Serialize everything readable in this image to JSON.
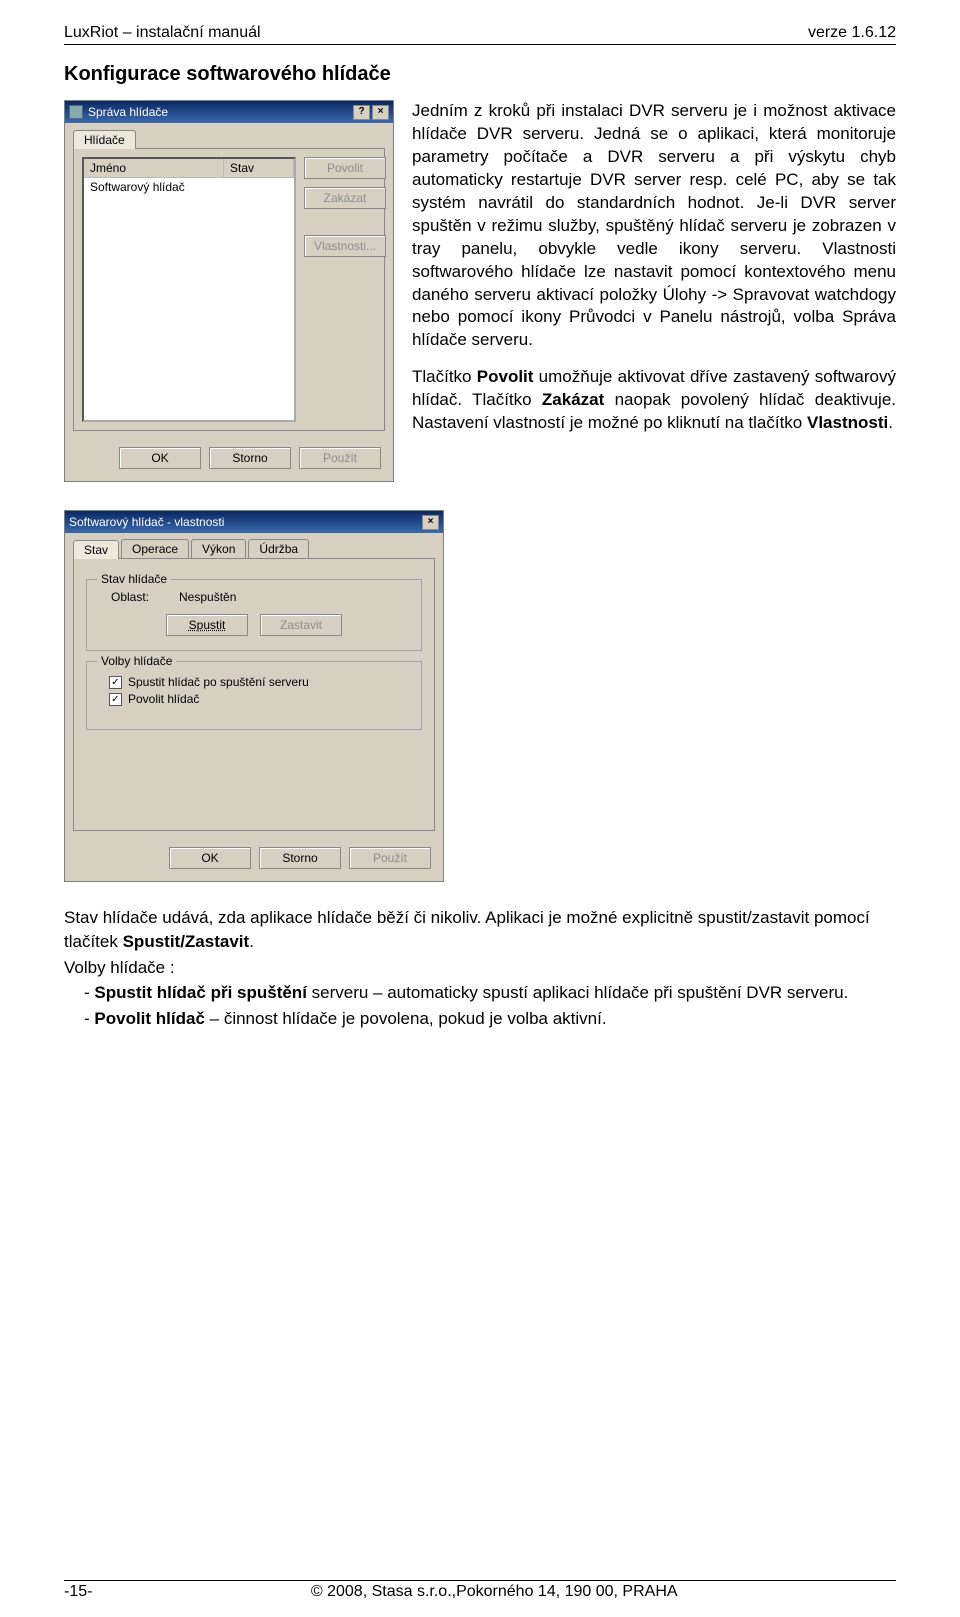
{
  "doc": {
    "header_left": "LuxRiot – instalační manuál",
    "header_right": "verze 1.6.12",
    "section_title": "Konfigurace softwarového hlídače",
    "footer_left": "-15-",
    "footer_center": "© 2008, Stasa s.r.o.,Pokorného 14, 190 00, PRAHA"
  },
  "dialog1": {
    "title": "Správa hlídače",
    "help_btn": "?",
    "close_btn": "×",
    "tab1": "Hlídače",
    "col_name": "Jméno",
    "col_state": "Stav",
    "row_name": "Softwarový hlídač",
    "btn_povolit": "Povolit",
    "btn_zakazat": "Zakázat",
    "btn_vlastnosti": "Vlastnosti...",
    "btn_ok": "OK",
    "btn_storno": "Storno",
    "btn_pouzit": "Použít"
  },
  "text1": {
    "p1": "Jedním z kroků při instalaci DVR serveru je i možnost aktivace hlídače DVR serveru. Jedná se o aplikaci, která monitoruje parametry počítače a DVR serveru a při výskytu chyb automaticky restartuje DVR server resp. celé PC, aby se tak systém navrátil do standardních hodnot. Je-li DVR server spuštěn v režimu služby, spuštěný hlídač serveru je zobrazen v tray panelu, obvykle vedle ikony serveru. Vlastnosti softwarového hlídače lze nastavit pomocí kontextového menu daného serveru aktivací položky Úlohy -> Spravovat watchdogy nebo pomocí ikony Průvodci v Panelu nástrojů, volba Správa hlídače serveru.",
    "p2a": "Tlačítko ",
    "p2b": "Povolit",
    "p2c": " umožňuje aktivovat dříve zastavený softwarový hlídač. Tlačítko ",
    "p2d": "Zakázat",
    "p2e": " naopak povolený hlídač deaktivuje. Nastavení vlastností je možné po kliknutí na tlačítko ",
    "p2f": "Vlastnosti",
    "p2g": "."
  },
  "dialog2": {
    "title": "Softwarový hlídač - vlastnosti",
    "close_btn": "×",
    "tabs": {
      "t1": "Stav",
      "t2": "Operace",
      "t3": "Výkon",
      "t4": "Údržba"
    },
    "fs1_legend": "Stav hlídače",
    "kv_label": "Oblast:",
    "kv_value": "Nespuštěn",
    "btn_spustit": "Spustit",
    "btn_zastavit": "Zastavit",
    "fs2_legend": "Volby hlídače",
    "cb1": "Spustit hlídač po spuštění serveru",
    "cb2": "Povolit hlídač",
    "btn_ok": "OK",
    "btn_storno": "Storno",
    "btn_pouzit": "Použít"
  },
  "text2": {
    "p1a": "Stav hlídače udává, zda aplikace hlídače běží či nikoliv. Aplikaci je možné explicitně spustit/zastavit pomocí tlačítek ",
    "p1b": "Spustit/Zastavit",
    "p1c": ".",
    "p2": "Volby hlídače :",
    "li1a": "-   ",
    "li1b": "Spustit hlídač při spuštění",
    "li1c": " serveru – automaticky spustí aplikaci hlídače při spuštění DVR serveru.",
    "li2a": "-   ",
    "li2b": "Povolit hlídač",
    "li2c": " – činnost hlídače je povolena, pokud je volba aktivní."
  }
}
